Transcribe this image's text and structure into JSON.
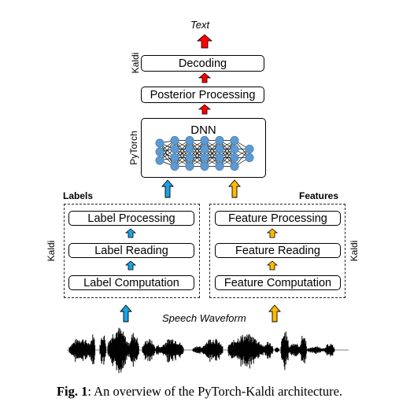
{
  "colors": {
    "output_arrow": "#ff0000",
    "label_arrow": "#1aa3e6",
    "feature_arrow": "#ffbb00",
    "neuron": "#5b9bd5"
  },
  "top": {
    "output_label": "Text",
    "kaldi_label": "Kaldi",
    "decoding": "Decoding",
    "posterior": "Posterior Processing"
  },
  "dnn": {
    "framework_label": "PyTorch",
    "title": "DNN",
    "layers": [
      3,
      4,
      4,
      4,
      4,
      4,
      2
    ]
  },
  "labels_group": {
    "title": "Labels",
    "side_label": "Kaldi",
    "steps": [
      "Label Processing",
      "Label Reading",
      "Label Computation"
    ]
  },
  "features_group": {
    "title": "Features",
    "side_label": "Kaldi",
    "steps": [
      "Feature Processing",
      "Feature Reading",
      "Feature Computation"
    ]
  },
  "input": {
    "label": "Speech Waveform"
  },
  "caption": {
    "prefix": "Fig. 1",
    "text": ": An overview of the PyTorch-Kaldi architecture."
  }
}
